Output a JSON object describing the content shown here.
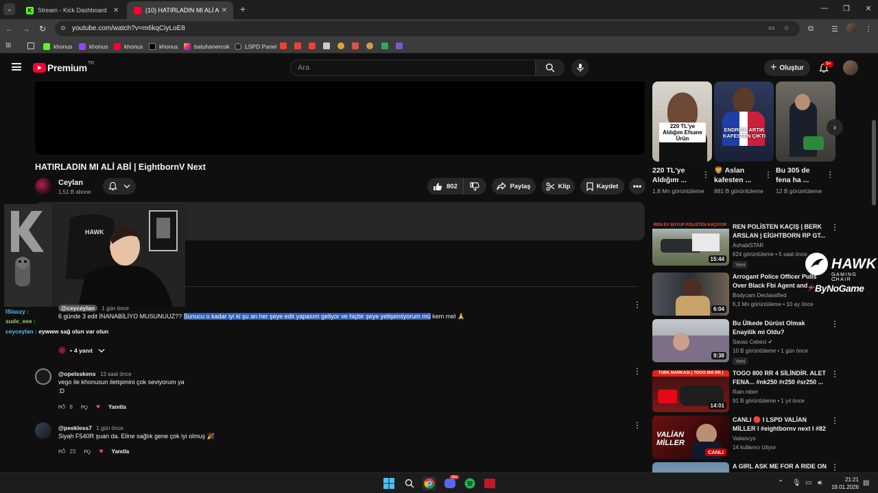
{
  "browser": {
    "tabs": [
      {
        "title": "Stream - Kick Dashboard",
        "favicon": "kick-icon",
        "active": false
      },
      {
        "title": "(10) HATIRLADIN MI ALİ ABİ | E",
        "favicon": "youtube-icon",
        "active": true
      }
    ],
    "url": "youtube.com/watch?v=m6kqCiyLoE8",
    "bookmarks": [
      "khonus",
      "khonus",
      "khonus",
      "khonus",
      "batuhanercok",
      "LSPD Panel"
    ]
  },
  "youtube": {
    "brand": "Premium",
    "country": "TR",
    "search_placeholder": "Ara",
    "create_label": "Oluştur",
    "notification_count": "9+"
  },
  "video": {
    "title": "HATIRLADIN MI ALİ ABİ | EightbornV Next",
    "channel": "Ceylan",
    "subscribers": "1,51 B abone",
    "likes": "802",
    "share_label": "Paylaş",
    "clip_label": "Klip",
    "save_label": "Kaydet"
  },
  "chat_overlay": [
    {
      "user": "lSlaxzy :",
      "color": "#4fc3f7"
    },
    {
      "user": "sude_eee :",
      "color": "#9ccc65"
    },
    {
      "user": "ceyceylan :",
      "color": "#4fc3f7",
      "text": "eywww sağ olun var olun"
    }
  ],
  "comments": {
    "pinned": {
      "handle": "@ceyceylan",
      "time": "1 gün önce",
      "text_before": "6 günde 3 edit İNANABİLİYO MUSUNUUZ?? ",
      "text_highlight": "Sunucu o kadar iyi ki şu an her şeye edit yapasım geliyor ve hiçbir şeye yetişemiyorum mü",
      "text_after": " kem mel 🙏",
      "replies": "4 yanıt"
    },
    "items": [
      {
        "handle": "@opelsskens",
        "time": "13 saat önce",
        "text_line1": "vego ile khonusun iletişimini çok seviyorum ya",
        "text_line2": ":D",
        "likes": "8",
        "reply": "Yanıtla"
      },
      {
        "handle": "@peekless7",
        "time": "1 gün önce",
        "text_line1": "Siyah F540R şuan da. Eline sağlık gene çok iyi olmuş 🎉",
        "likes": "23",
        "reply": "Yanıtla"
      }
    ]
  },
  "shorts": [
    {
      "title": "220 TL'ye Aldığım ...",
      "views": "1,8 Mn görüntüleme",
      "thumb_text": "220 TL'ye Aldığım Efsane Ürün"
    },
    {
      "title": "🦁 Aslan kafesten ...",
      "views": "881 B görüntüleme",
      "thumb_text": "ENDRICK ARTIK KAFESTEN ÇIKTI"
    },
    {
      "title": "Bu 305 de fena ha ...",
      "views": "12 B görüntüleme"
    }
  ],
  "recommendations": [
    {
      "title": "REN POLİSTEN KAÇIŞ | BERK ARSLAN | EİGHTBORN RP GT...",
      "channel": "AshabiSTAR",
      "meta": "624 görüntüleme • 5 saat önce",
      "badge": "Yeni",
      "duration": "15:44",
      "thumb_text": "REN EV SOYUP POLİSTEN KAÇIYOR"
    },
    {
      "title": "Arrogant Police Officer Pulls Over Black Fbi Agent and ...",
      "channel": "Bodycam Declassified",
      "meta": "6,3 Mn görüntüleme • 10 ay önce",
      "duration": "6:04"
    },
    {
      "title": "Bu Ülkede Dürüst Olmak Enayilik mi Oldu?",
      "channel": "Savas Cebeci ✔",
      "meta": "10 B görüntüleme • 1 gün önce",
      "badge": "Yeni",
      "duration": "9:38"
    },
    {
      "title": "TOGO 800 RR 4 SİLİNDİR. ALET FENA... #nk250 #r250 #sr250 ...",
      "channel": "Rain.riderr",
      "meta": "91 B görüntüleme • 1 yıl önce",
      "duration": "14:01",
      "thumb_text": "TÜRK MARKASI ( TOGO 800 RR )"
    },
    {
      "title": "CANLI 🔴 I LSPD VALİAN MİLLER I #eightbornv next I #82",
      "channel": "Valiancys",
      "meta": "14 kullanıcı izliyor",
      "live": "CANLI",
      "thumb_text": "VALİAN MİLLER"
    },
    {
      "title": "A GIRL ASK ME FOR A RIDE ON"
    }
  ],
  "overlay_brands": {
    "hawk": "HAWK",
    "hawk_sub": "GAMING CHAIR",
    "bynogame": "ByNoGame"
  },
  "taskbar": {
    "time": "21:21",
    "date": "19.01.2026",
    "discord_badge": "99+"
  }
}
